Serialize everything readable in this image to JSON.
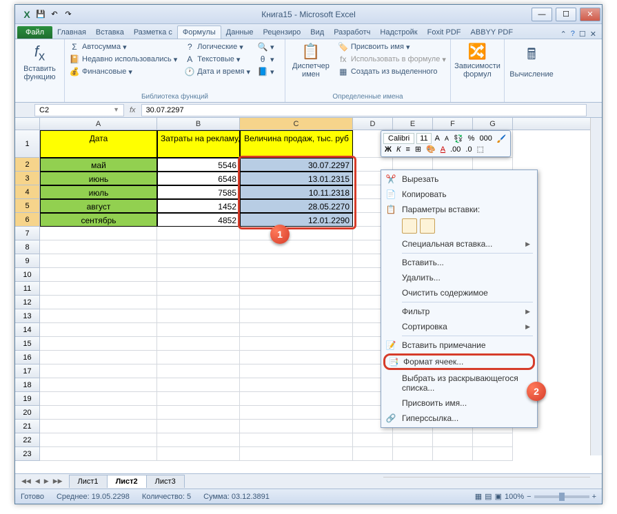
{
  "title": "Книга15 - Microsoft Excel",
  "tabs": {
    "file": "Файл",
    "items": [
      "Главная",
      "Вставка",
      "Разметка с",
      "Формулы",
      "Данные",
      "Рецензиро",
      "Вид",
      "Разработч",
      "Надстройк",
      "Foxit PDF",
      "ABBYY PDF"
    ],
    "active_index": 3
  },
  "ribbon": {
    "insert_fn": "Вставить\nфункцию",
    "autosum": "Автосумма",
    "recent": "Недавно использовались",
    "financial": "Финансовые",
    "logical": "Логические",
    "text": "Текстовые",
    "datetime": "Дата и время",
    "lib_label": "Библиотека функций",
    "name_mgr": "Диспетчер\nимен",
    "assign_name": "Присвоить имя",
    "use_in_formula": "Использовать в формуле",
    "create_from_sel": "Создать из выделенного",
    "names_label": "Определенные имена",
    "dependencies": "Зависимости\nформул",
    "calculation": "Вычисление"
  },
  "namebox": "C2",
  "formula": "30.07.2297",
  "columns": [
    "A",
    "B",
    "C",
    "D",
    "E",
    "F",
    "G"
  ],
  "headers": {
    "date": "Дата",
    "cost": "Затраты на рекламу, тыс. руб.",
    "sales": "Величина продаж, тыс. руб"
  },
  "data_rows": [
    {
      "n": "2",
      "month": "май",
      "cost": "5546",
      "sales": "30.07.2297"
    },
    {
      "n": "3",
      "month": "июнь",
      "cost": "6548",
      "sales": "13.01.2315"
    },
    {
      "n": "4",
      "month": "июль",
      "cost": "7585",
      "sales": "10.11.2318"
    },
    {
      "n": "5",
      "month": "август",
      "cost": "1452",
      "sales": "28.05.2270"
    },
    {
      "n": "6",
      "month": "сентябрь",
      "cost": "4852",
      "sales": "12.01.2290"
    }
  ],
  "empty_rows": [
    "7",
    "8",
    "9",
    "10",
    "11",
    "12",
    "13",
    "14",
    "15",
    "16",
    "17",
    "18",
    "19",
    "20",
    "21",
    "22",
    "23"
  ],
  "mini_toolbar": {
    "font": "Calibri",
    "size": "11"
  },
  "context_menu": {
    "cut": "Вырезать",
    "copy": "Копировать",
    "paste_opts": "Параметры вставки:",
    "paste_special": "Специальная вставка...",
    "insert": "Вставить...",
    "delete": "Удалить...",
    "clear": "Очистить содержимое",
    "filter": "Фильтр",
    "sort": "Сортировка",
    "comment": "Вставить примечание",
    "format_cells": "Формат ячеек...",
    "dropdown": "Выбрать из раскрывающегося списка...",
    "name": "Присвоить имя...",
    "hyperlink": "Гиперссылка..."
  },
  "sheet_tabs": [
    "Лист1",
    "Лист2",
    "Лист3"
  ],
  "active_sheet": 1,
  "statusbar": {
    "ready": "Готово",
    "avg_label": "Среднее:",
    "avg": "19.05.2298",
    "count_label": "Количество:",
    "count": "5",
    "sum_label": "Сумма:",
    "sum": "03.12.3891",
    "zoom": "100%"
  },
  "callouts": {
    "one": "1",
    "two": "2"
  }
}
